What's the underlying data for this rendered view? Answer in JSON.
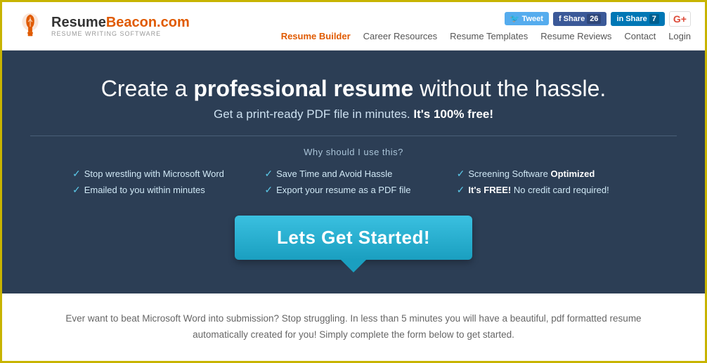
{
  "header": {
    "logo": {
      "name_part1": "Resume",
      "name_part2": "Beacon.com",
      "tagline": "RESUME WRITING SOFTWARE"
    },
    "social": {
      "twitter_label": "Tweet",
      "facebook_label": "Share",
      "facebook_count": "26",
      "linkedin_label": "Share",
      "linkedin_count": "7",
      "google_icon": "G+"
    },
    "nav": [
      {
        "label": "Resume Builder",
        "active": true
      },
      {
        "label": "Career Resources",
        "active": false
      },
      {
        "label": "Resume Templates",
        "active": false
      },
      {
        "label": "Resume Reviews",
        "active": false
      },
      {
        "label": "Contact",
        "active": false
      },
      {
        "label": "Login",
        "active": false
      }
    ]
  },
  "hero": {
    "headline_prefix": "Create a ",
    "headline_bold": "professional resume",
    "headline_suffix": " without the hassle.",
    "subheadline_prefix": "Get a print-ready PDF file in minutes. ",
    "subheadline_bold": "It's 100% free!",
    "why_label": "Why should I use this?",
    "features": [
      {
        "text": "Stop wrestling with Microsoft Word"
      },
      {
        "text": "Save Time and Avoid Hassle"
      },
      {
        "text": "Screening Software ",
        "bold": "Optimized"
      },
      {
        "text": "Emailed to you within minutes"
      },
      {
        "text": "Export your resume as a PDF file"
      },
      {
        "text": "It's FREE!",
        "suffix": " No credit card required!"
      }
    ],
    "cta_label": "Lets Get Started!"
  },
  "bottom": {
    "description": "Ever want to beat Microsoft Word into submission? Stop struggling. In less than 5 minutes you will have a beautiful, pdf formatted resume automatically created for you! Simply complete the form below to get started."
  }
}
